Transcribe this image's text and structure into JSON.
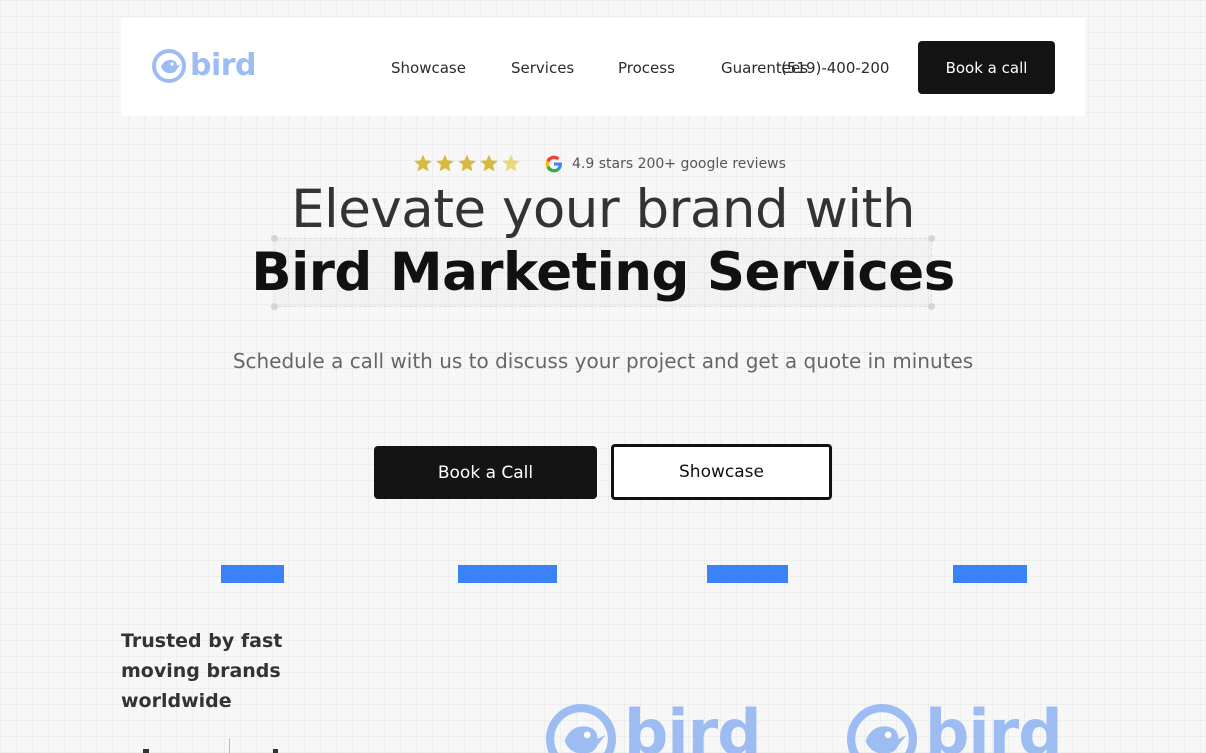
{
  "nav": {
    "logo_text": "bird",
    "links": [
      "Showcase",
      "Services",
      "Process",
      "Guarentees"
    ],
    "phone": "(519)-400-200",
    "cta": "Book a call"
  },
  "rating": {
    "stars": 4.5,
    "text": "4.9 stars 200+ google reviews"
  },
  "hero": {
    "headline_line1": "Elevate your brand with",
    "headline_line2": "Bird Marketing Services",
    "subheadline": "Schedule a call with us to discuss your project and get a quote in minutes",
    "primary_cta": "Book a Call",
    "secondary_cta": "Showcase"
  },
  "trusted": {
    "text": "Trusted by fast moving brands worldwide"
  },
  "brand_logos": [
    "bird",
    "bird"
  ],
  "colors": {
    "accent_blue": "#3b82f6",
    "logo_blue": "#9dbdf2",
    "star_gold": "#e2c04f",
    "dark": "#141414"
  },
  "icons": [
    "bird-logo-icon",
    "star-icon",
    "google-icon"
  ]
}
